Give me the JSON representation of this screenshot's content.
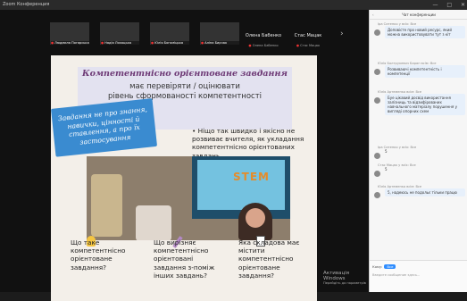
{
  "window": {
    "title": "Zoom Конференция",
    "controls": [
      "—",
      "□",
      "✕"
    ]
  },
  "participants": [
    {
      "name": "Людмила Погарська",
      "muted": true
    },
    {
      "name": "Надія Ляхоцька",
      "muted": true
    },
    {
      "name": "Юлія Богоміцька",
      "muted": true
    },
    {
      "name": "Аліна Бирчак",
      "muted": true
    }
  ],
  "name_cards": [
    {
      "main": "Олена Бабенко",
      "sub": "Олена Бабенко"
    },
    {
      "main": "Стас Мацак",
      "sub": "Стас Мацак"
    }
  ],
  "slide": {
    "title": "Компетентнісно орієнтоване завдання",
    "subtitle": [
      "має перевіряти / оцінювати",
      "рівень сформованості компетентності"
    ],
    "callout": "Завдання не про знання, навички, цінності й ставлення, а про їх застосування",
    "bullet": "• Ніщо так швидко і якісно не розвиває вчителя, як укладання компетентнісно орієнтованих завдань.",
    "photo_sign": "STEM",
    "columns": [
      "Що таке компетентнісно орієнтоване завдання?",
      "Що вирізняє компетентнісно орієнтовані завдання з-поміж інших завдань?",
      "Яка складова має містити компетентнісно орієнтоване завдання?"
    ]
  },
  "chat": {
    "title": "Чат конференции",
    "messages": [
      {
        "from": "Іра Ситенко у всіх: Все",
        "text": "Доповісте про новий ресурс, який можна використовувати тут з кіт"
      },
      {
        "from": "Юлія Болтрукевич Баран  всім: Все",
        "text": "Розвиваючі компетентність і компетенції"
      },
      {
        "from": "Юлія Артеменко всім: Все",
        "text": "Буе цікавий досвід використання залізниць та відзифірованих навчального матеріалу порушення у вигляді опорних схем"
      },
      {
        "from": "Іра Ситенко у всіх: Все",
        "text": "5"
      },
      {
        "from": "Стас Мацак у всіх: Все",
        "text": "5"
      },
      {
        "from": "Юлія Артеменко всім: Все",
        "text": "5, надеюсь не подольє тільки працю"
      }
    ],
    "to_label": "Кому:",
    "to_value": "Все",
    "input_hint": "Введите сообщение здесь..."
  },
  "watermark": {
    "title": "Активація Windows",
    "sub": "Перейдіть до параметрів"
  }
}
